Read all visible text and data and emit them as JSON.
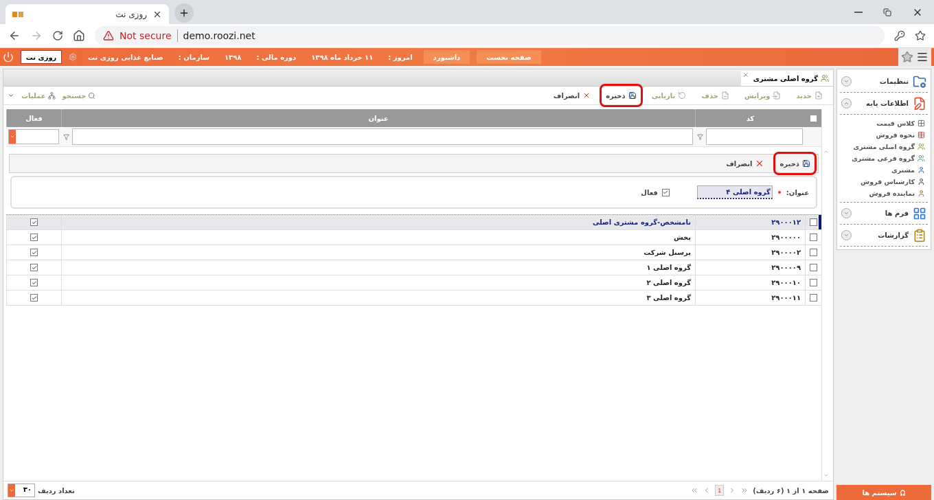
{
  "browser": {
    "tab_title": "روزی نت",
    "security": "Not secure",
    "url": "demo.roozi.net"
  },
  "app_bar": {
    "user": "روزی نت",
    "buttons": [
      "صفحه نخست",
      "داشبورد"
    ],
    "info": [
      {
        "label": "امروز :",
        "value": "۱۱ خرداد ماه ۱۳۹۸"
      },
      {
        "label": "دوره مالی :",
        "value": "۱۳۹۸"
      },
      {
        "label": "سازمان :",
        "value": "صنایع غذایی روزی نت"
      }
    ]
  },
  "page_tab": {
    "title": "گروه اصلی مشتری"
  },
  "toolbar": {
    "actions": [
      {
        "label": "جدید",
        "disabled": true,
        "highlighted": false
      },
      {
        "label": "ویرایش",
        "disabled": true,
        "highlighted": false
      },
      {
        "label": "حذف",
        "disabled": true,
        "highlighted": false
      },
      {
        "label": "بازیابی",
        "disabled": true,
        "highlighted": false
      },
      {
        "label": "ذخیره",
        "disabled": false,
        "highlighted": true
      },
      {
        "label": "انصراف",
        "disabled": false,
        "highlighted": false
      }
    ],
    "tools": [
      "جستجو",
      "عملیات"
    ]
  },
  "grid": {
    "all_selected": false,
    "columns": [
      "کد",
      "عنوان",
      "فعال"
    ],
    "editor": {
      "actions": [
        {
          "label": "ذخیره",
          "highlighted": true
        },
        {
          "label": "انصراف",
          "highlighted": false
        }
      ],
      "title_label": "عنوان:",
      "required": true,
      "title_value": "گروه اصلی ۴",
      "active_label": "فعال",
      "active": true
    },
    "rows": [
      {
        "code": "۲۹۰۰۰۱۲",
        "title": "نامشخص-گروه مشتری اصلی",
        "active": true,
        "checked": false,
        "selected": true
      },
      {
        "code": "۲۹۰۰۰۰۰",
        "title": "پخش",
        "active": true,
        "checked": false,
        "selected": false
      },
      {
        "code": "۲۹۰۰۰۰۲",
        "title": "پرسنل شرکت",
        "active": true,
        "checked": false,
        "selected": false
      },
      {
        "code": "۲۹۰۰۰۰۹",
        "title": "گروه اصلی ۱",
        "active": true,
        "checked": false,
        "selected": false
      },
      {
        "code": "۲۹۰۰۰۱۰",
        "title": "گروه اصلی ۲",
        "active": true,
        "checked": false,
        "selected": false
      },
      {
        "code": "۲۹۰۰۰۱۱",
        "title": "گروه اصلی ۳",
        "active": true,
        "checked": false,
        "selected": false
      }
    ]
  },
  "pager": {
    "summary": "صفحه ۱ از ۱ (۶ ردیف)",
    "page": "1",
    "page_size": "۳۰",
    "page_size_label": "تعداد ردیف"
  },
  "sidebar": {
    "groups": [
      {
        "label": "تنظیمات",
        "expanded": false
      },
      {
        "label": "اطلاعات پایه",
        "expanded": true,
        "children": [
          {
            "label": "کلاس قیمت"
          },
          {
            "label": "نحوه فروش"
          },
          {
            "label": "گروه اصلی مشتری"
          },
          {
            "label": "گروه فرعی مشتری"
          },
          {
            "label": "مشتری"
          },
          {
            "label": "کارشناس فروش"
          },
          {
            "label": "نماینده فروش"
          }
        ]
      },
      {
        "label": "فرم ها",
        "expanded": false
      },
      {
        "label": "گزارشات",
        "expanded": false
      }
    ],
    "footer": "سیستم ها"
  }
}
